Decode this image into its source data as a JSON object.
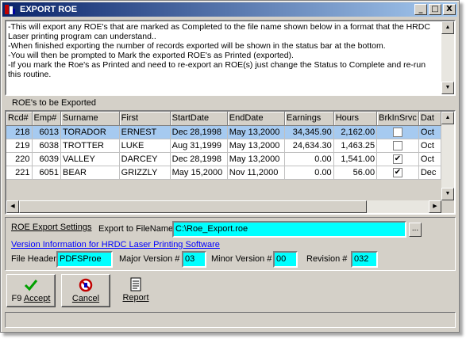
{
  "window": {
    "title": "EXPORT ROE",
    "buttons": {
      "minimize": "_",
      "maximize": "□",
      "close": "X"
    }
  },
  "info": {
    "lines": [
      "-This will export any ROE's that are marked as Completed to the file name shown below in a format that the HRDC Laser printing program can understand..",
      "-When finished exporting the number of records exported will be shown in the status bar at the bottom.",
      "-You will then be prompted to Mark the exported ROE's as Printed (exported).",
      "-If you mark the Roe's as Printed and need to re-export an ROE(s) just change the Status to Complete and re-run this routine."
    ]
  },
  "grid": {
    "section_label": "ROE's to be Exported",
    "columns": [
      "Rcd#",
      "Emp#",
      "Surname",
      "First",
      "StartDate",
      "EndDate",
      "Earnings",
      "Hours",
      "BrkInSrvc",
      "Dat"
    ],
    "rows": [
      {
        "rcd": "218",
        "emp": "6013",
        "surname": "TORADOR",
        "first": "ERNEST",
        "start": "Dec 28,1998",
        "end": "May 13,2000",
        "earnings": "34,345.90",
        "hours": "2,162.00",
        "brk": false,
        "dat": "Oct",
        "selected": true
      },
      {
        "rcd": "219",
        "emp": "6038",
        "surname": "TROTTER",
        "first": "LUKE",
        "start": "Aug 31,1999",
        "end": "May 13,2000",
        "earnings": "24,634.30",
        "hours": "1,463.25",
        "brk": false,
        "dat": "Oct",
        "selected": false
      },
      {
        "rcd": "220",
        "emp": "6039",
        "surname": "VALLEY",
        "first": "DARCEY",
        "start": "Dec 28,1998",
        "end": "May 13,2000",
        "earnings": "0.00",
        "hours": "1,541.00",
        "brk": true,
        "dat": "Oct",
        "selected": false
      },
      {
        "rcd": "221",
        "emp": "6051",
        "surname": "BEAR",
        "first": "GRIZZLY",
        "start": "May 15,2000",
        "end": "Nov 11,2000",
        "earnings": "0.00",
        "hours": "56.00",
        "brk": true,
        "dat": "Dec",
        "selected": false
      }
    ]
  },
  "settings": {
    "title": "ROE Export Settings",
    "export_label": "Export to FileName",
    "export_value": "C:\\Roe_Export.roe",
    "browse_label": "...",
    "version_link": "Version Information for HRDC Laser Printing Software",
    "file_header_label": "File Header",
    "file_header_value": "PDFSProe",
    "major_label": "Major Version #",
    "major_value": "03",
    "minor_label": "Minor Version #",
    "minor_value": "00",
    "revision_label": "Revision #",
    "revision_value": "032"
  },
  "toolbar": {
    "accept_key": "F9",
    "accept_label": "Accept",
    "cancel_label": "Cancel",
    "report_label": "Report",
    "accept_icon": "checkmark-icon",
    "cancel_icon": "cancel-icon",
    "report_icon": "report-icon"
  },
  "status": {
    "text": ""
  },
  "colors": {
    "title_start": "#0a246a",
    "title_end": "#a6caf0",
    "field_bg": "#00ffff",
    "selected_row": "#a6caf0",
    "link": "#0000ff"
  }
}
